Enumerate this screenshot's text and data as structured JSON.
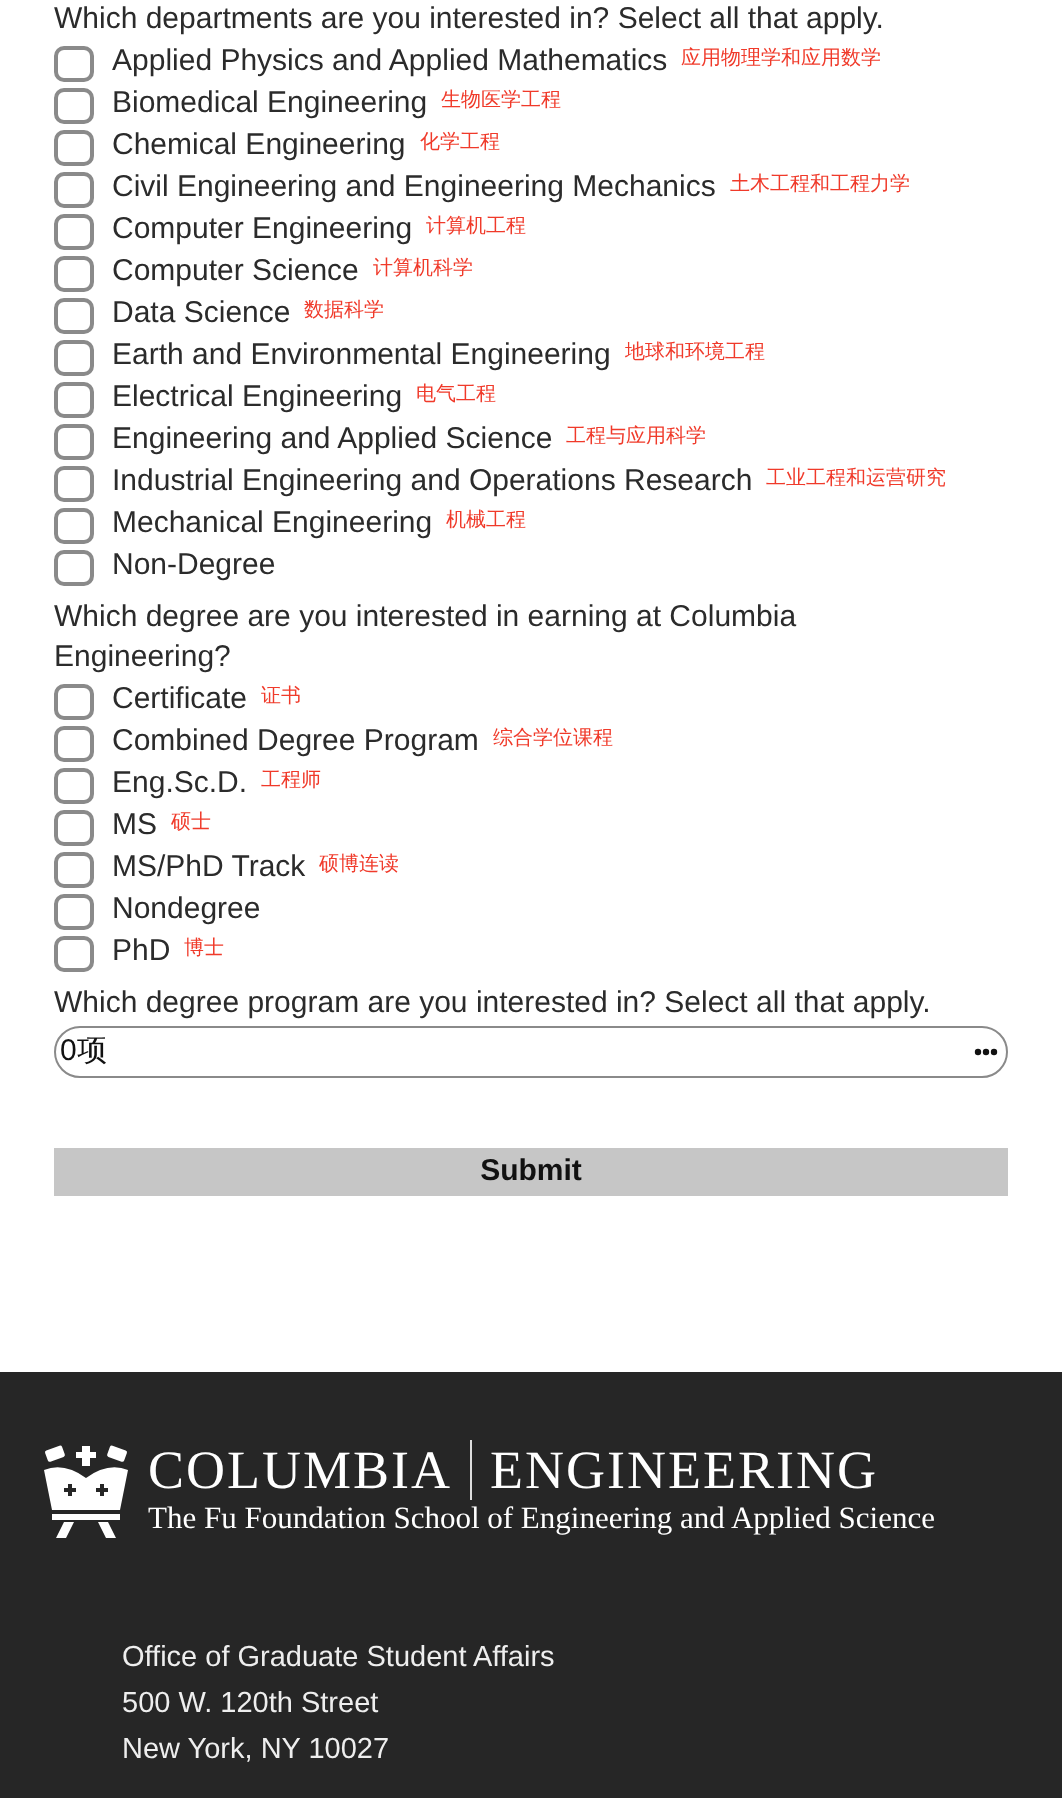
{
  "sections": [
    {
      "kind": "checklist",
      "question": "Which departments are you interested in? Select all that apply.",
      "options": [
        {
          "label": "Applied Physics and Applied Mathematics",
          "note": "应用物理学和应用数学",
          "checked": false
        },
        {
          "label": "Biomedical Engineering",
          "note": "生物医学工程",
          "checked": false
        },
        {
          "label": "Chemical Engineering",
          "note": "化学工程",
          "checked": false
        },
        {
          "label": "Civil Engineering and Engineering Mechanics",
          "note": "土木工程和工程力学",
          "checked": false
        },
        {
          "label": "Computer Engineering",
          "note": "计算机工程",
          "checked": false
        },
        {
          "label": "Computer Science",
          "note": "计算机科学",
          "checked": false
        },
        {
          "label": "Data Science",
          "note": "数据科学",
          "checked": false
        },
        {
          "label": "Earth and Environmental Engineering",
          "note": "地球和环境工程",
          "checked": false
        },
        {
          "label": "Electrical Engineering",
          "note": "电气工程",
          "checked": false
        },
        {
          "label": "Engineering and Applied Science",
          "note": "工程与应用科学",
          "checked": false
        },
        {
          "label": "Industrial Engineering and Operations Research",
          "note": "工业工程和运营研究",
          "checked": false
        },
        {
          "label": "Mechanical Engineering",
          "note": "机械工程",
          "checked": false
        },
        {
          "label": "Non-Degree",
          "checked": false
        }
      ]
    },
    {
      "kind": "checklist",
      "question": "Which degree are you interested in earning at Columbia Engineering?",
      "options": [
        {
          "label": "Certificate",
          "note": "证书",
          "checked": false
        },
        {
          "label": "Combined Degree Program",
          "note": "综合学位课程",
          "checked": false
        },
        {
          "label": "Eng.Sc.D.",
          "note": "工程师",
          "checked": false
        },
        {
          "label": "MS",
          "note": "硕士",
          "checked": false
        },
        {
          "label": "MS/PhD Track",
          "note": "硕博连读",
          "checked": false
        },
        {
          "label": "Nondegree",
          "checked": false
        },
        {
          "label": "PhD",
          "note": "博士",
          "checked": false
        }
      ]
    },
    {
      "kind": "dropdown",
      "question": "Which degree program are you interested in? Select all that apply.",
      "value": "0项"
    }
  ],
  "submit": "Submit",
  "footer": {
    "logo": {
      "name": "COLUMBIA",
      "school": "ENGINEERING",
      "tagline": "The Fu Foundation School of Engineering and Applied Science"
    },
    "address": [
      "Office of Graduate Student Affairs",
      "500 W. 120th Street",
      "New York, NY 10027"
    ]
  }
}
